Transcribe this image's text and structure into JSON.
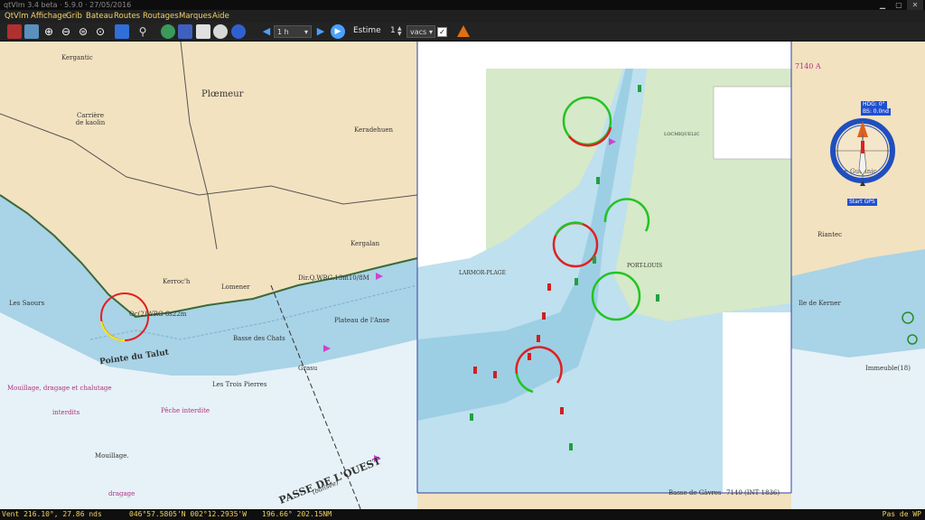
{
  "window": {
    "title": "qtVlm 3.4 beta · 5.9.0 · 27/05/2016"
  },
  "menu": [
    "QtVlm",
    "Affichage",
    "Grib",
    "Bateau",
    "Routes",
    "Routages",
    "Marques",
    "Aide"
  ],
  "toolbar": {
    "time_step": "1 h",
    "estime_label": "Estime",
    "estime_value": "1",
    "estime_unit": "vacs",
    "estime_checked": true
  },
  "map_labels": {
    "ploemeur": "Plœmeur",
    "kerroch": "Kerroc'h",
    "lomener": "Lomener",
    "pointe_talut": "Pointe du Talut",
    "kergalan": "Kergalan",
    "kergantic": "Kergantic",
    "keradehuen": "Keradehuen",
    "carriere": "Carrière de kaolin",
    "light1": "Oc(2)WRG 6s22m",
    "light2": "Dir.Q.WRG.13m10/8M",
    "les_saours": "Les Saours",
    "basse_chats": "Basse des Chats",
    "plateau_anse": "Plateau de l'Anse",
    "trois_pierres": "Les Trois Pierres",
    "grasu": "Grasu",
    "peche": "Pêche interdite",
    "mouillage": "Mouillage, dragage et chalutage",
    "interdits": "interdits",
    "mouillage2": "Mouillage.",
    "dragage": "dragage",
    "passe": "PASSE DE L'OUEST",
    "balisee": "(balisée)",
    "guennic": "Le Guennic",
    "riantec": "Riantec",
    "kerner": "Ile de Kerner",
    "immeuble": "Immeuble(18)",
    "chart_no": "7140 (INT 1836)",
    "chart_no2": "7140 A",
    "gavres": "Basse de Gâvres",
    "port_louis": "PORT-LOUIS",
    "larmor": "LARMOR-PLAGE",
    "locmiquelic": "LOCMIQUELIC",
    "hdg": "HDG: 0°",
    "bs": "BS: 0.0nd",
    "start_gps": "Start GPS"
  },
  "status": {
    "wind": "Vent 216.10°,  27.86 nds",
    "position": "046°57.5805'N  002°12.2935'W",
    "bearing": "196.66°  202.15NM",
    "right": "Pas de WP"
  },
  "colors": {
    "menu": "#f2d26a",
    "status_text": "#f0d060",
    "circle_red": "#e02020",
    "circle_green": "#22c422",
    "circle_yellow": "#f0f000"
  }
}
